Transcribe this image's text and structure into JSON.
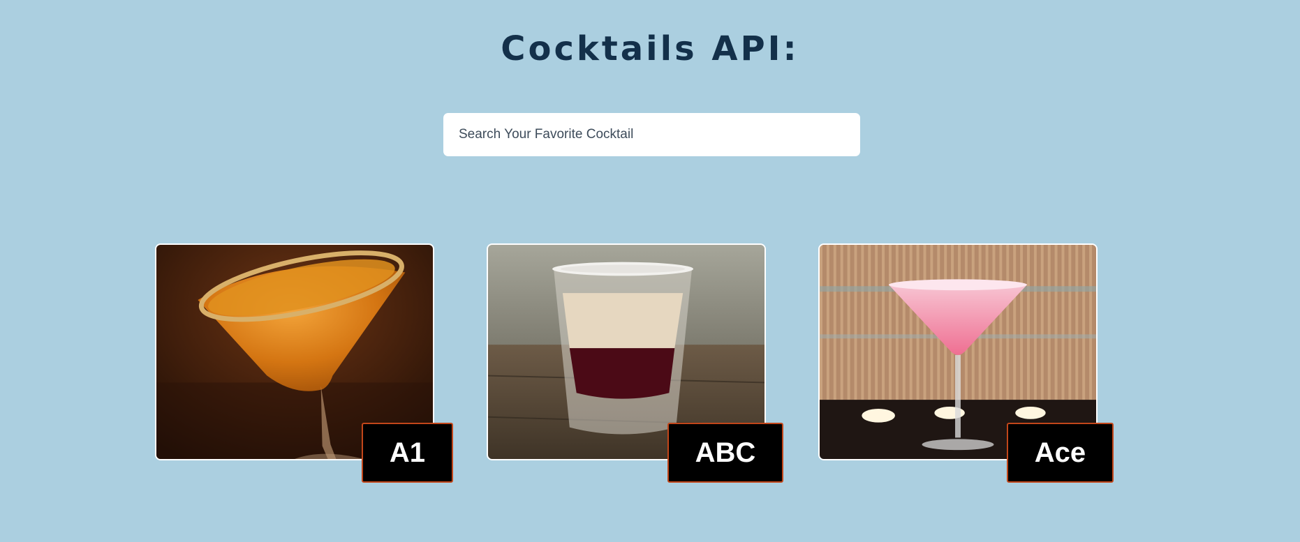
{
  "page": {
    "title": "Cocktails API:"
  },
  "search": {
    "placeholder": "Search Your Favorite Cocktail",
    "value": ""
  },
  "cocktails": [
    {
      "name": "A1",
      "image": "orange-martini-with-sugared-rim-photo"
    },
    {
      "name": "ABC",
      "image": "layered-shot-glass-photo"
    },
    {
      "name": "Ace",
      "image": "pink-martini-with-candles-photo"
    }
  ],
  "colors": {
    "background": "#abcfe0",
    "title": "#13304a",
    "label_background": "#000000",
    "label_border": "#c2461a",
    "label_text": "#ffffff"
  }
}
